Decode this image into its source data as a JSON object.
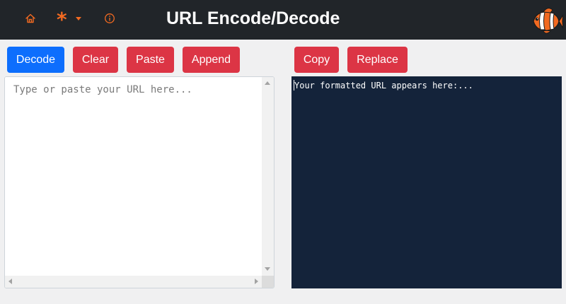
{
  "header": {
    "title": "URL Encode/Decode",
    "icons": [
      "home-icon",
      "asterisk-icon",
      "caret-down-icon",
      "info-icon",
      "clownfish-logo"
    ],
    "accent_color": "#f26a21",
    "background_color": "#212529"
  },
  "toolbar_left": {
    "decode_label": "Decode",
    "clear_label": "Clear",
    "paste_label": "Paste",
    "append_label": "Append"
  },
  "toolbar_right": {
    "copy_label": "Copy",
    "replace_label": "Replace"
  },
  "input": {
    "placeholder": "Type or paste your URL here...",
    "value": ""
  },
  "output": {
    "text": "Your formatted URL appears here:..."
  },
  "colors": {
    "primary_button": "#0d6efd",
    "danger_button": "#dc3545",
    "output_background": "#14233a"
  }
}
